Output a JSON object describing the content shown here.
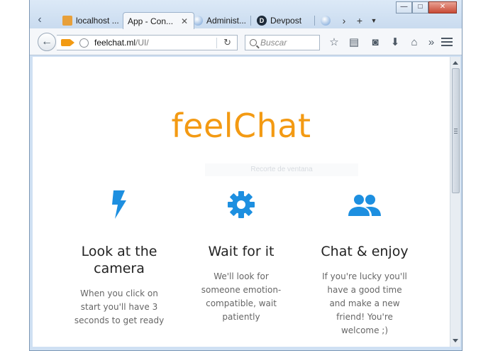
{
  "browser": {
    "tabs": [
      {
        "label": "localhost ...",
        "active": false
      },
      {
        "label": "App - Con...",
        "active": true
      },
      {
        "label": "Administ...",
        "active": false
      },
      {
        "label": "Devpost",
        "active": false
      }
    ],
    "url_host": "feelchat.ml",
    "url_path": "/UI/",
    "search_placeholder": "Buscar",
    "window_buttons": {
      "minimize": "—",
      "maximize": "□",
      "close": "✕"
    }
  },
  "page": {
    "brand": "feelChat",
    "overlay_text": "Recorte de ventana",
    "features": [
      {
        "icon": "lightning-icon",
        "title": "Look at the camera",
        "text": "When you click on start you'll have 3 seconds to get ready"
      },
      {
        "icon": "gear-icon",
        "title": "Wait for it",
        "text": "We'll look for someone emotion-compatible, wait patiently"
      },
      {
        "icon": "people-icon",
        "title": "Chat & enjoy",
        "text": "If you're lucky you'll have a good time and make a new friend! You're welcome ;)"
      }
    ]
  },
  "colors": {
    "brand": "#f39a13",
    "icon_blue": "#1d8fe0"
  }
}
